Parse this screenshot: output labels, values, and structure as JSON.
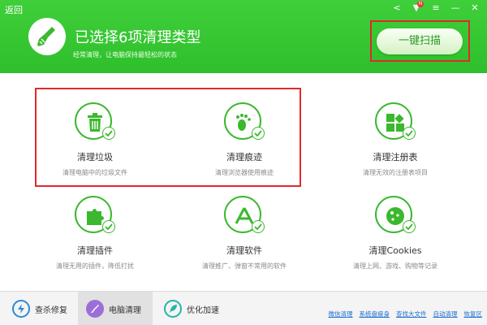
{
  "header": {
    "back_label": "返回",
    "title": "已选择6项清理类型",
    "subtitle": "经常清理，让电脑保持最轻松的状态",
    "scan_button": "一键扫描",
    "badge": "N"
  },
  "items": [
    {
      "title": "清理垃圾",
      "desc": "清理电脑中的垃圾文件",
      "icon": "trash-icon"
    },
    {
      "title": "清理痕迹",
      "desc": "清理浏览器使用痕迹",
      "icon": "footprint-icon"
    },
    {
      "title": "清理注册表",
      "desc": "清理无效的注册表项目",
      "icon": "registry-icon"
    },
    {
      "title": "清理插件",
      "desc": "清理无用的插件，降低打扰",
      "icon": "puzzle-icon"
    },
    {
      "title": "清理软件",
      "desc": "清理推广、弹窗不常用的软件",
      "icon": "app-store-icon"
    },
    {
      "title": "清理Cookies",
      "desc": "清理上网、游戏、购物等记录",
      "icon": "cookie-icon"
    }
  ],
  "bottom_tabs": [
    {
      "label": "查杀修复",
      "icon": "shield-bolt-icon"
    },
    {
      "label": "电脑清理",
      "icon": "broom-icon"
    },
    {
      "label": "优化加速",
      "icon": "rocket-icon"
    }
  ],
  "bottom_links": [
    "微信清理",
    "系统盘瘦身",
    "查找大文件",
    "自动清理",
    "恢复区"
  ],
  "colors": {
    "accent": "#3bb82e",
    "header": "#36c832",
    "highlight": "#e0292e",
    "link": "#1d6fd1"
  }
}
